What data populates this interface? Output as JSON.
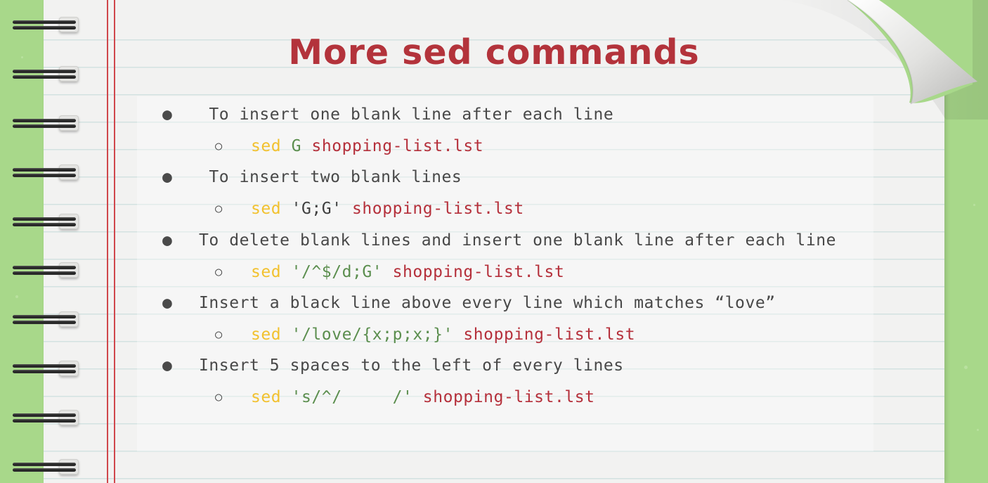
{
  "title": "More sed commands",
  "colors": {
    "background": "#a8d88a",
    "paper": "#f2f2f1",
    "title": "#b3333b",
    "command": "#f2c12e",
    "argument_green": "#5b8e4e",
    "filename": "#b5303b",
    "text": "#484848"
  },
  "items": [
    {
      "text": " To insert one blank line after each line",
      "command": {
        "cmd": "sed",
        "arg": "G",
        "file": "shopping-list.lst"
      }
    },
    {
      "text": " To insert two blank lines",
      "command": {
        "cmd": "sed",
        "arg": "'G;G'",
        "file": "shopping-list.lst"
      }
    },
    {
      "text": "To delete blank lines and insert one blank line after each line",
      "command": {
        "cmd": "sed",
        "arg": "'/^$/d;G'",
        "file": "shopping-list.lst"
      }
    },
    {
      "text": "Insert a black line above every line which matches “love”",
      "command": {
        "cmd": "sed",
        "arg": "'/love/{x;p;x;}'",
        "file": "shopping-list.lst"
      }
    },
    {
      "text": "Insert 5 spaces to the left of every lines",
      "command": {
        "cmd": "sed",
        "arg": "'s/^/     /'",
        "file": "shopping-list.lst"
      }
    }
  ]
}
